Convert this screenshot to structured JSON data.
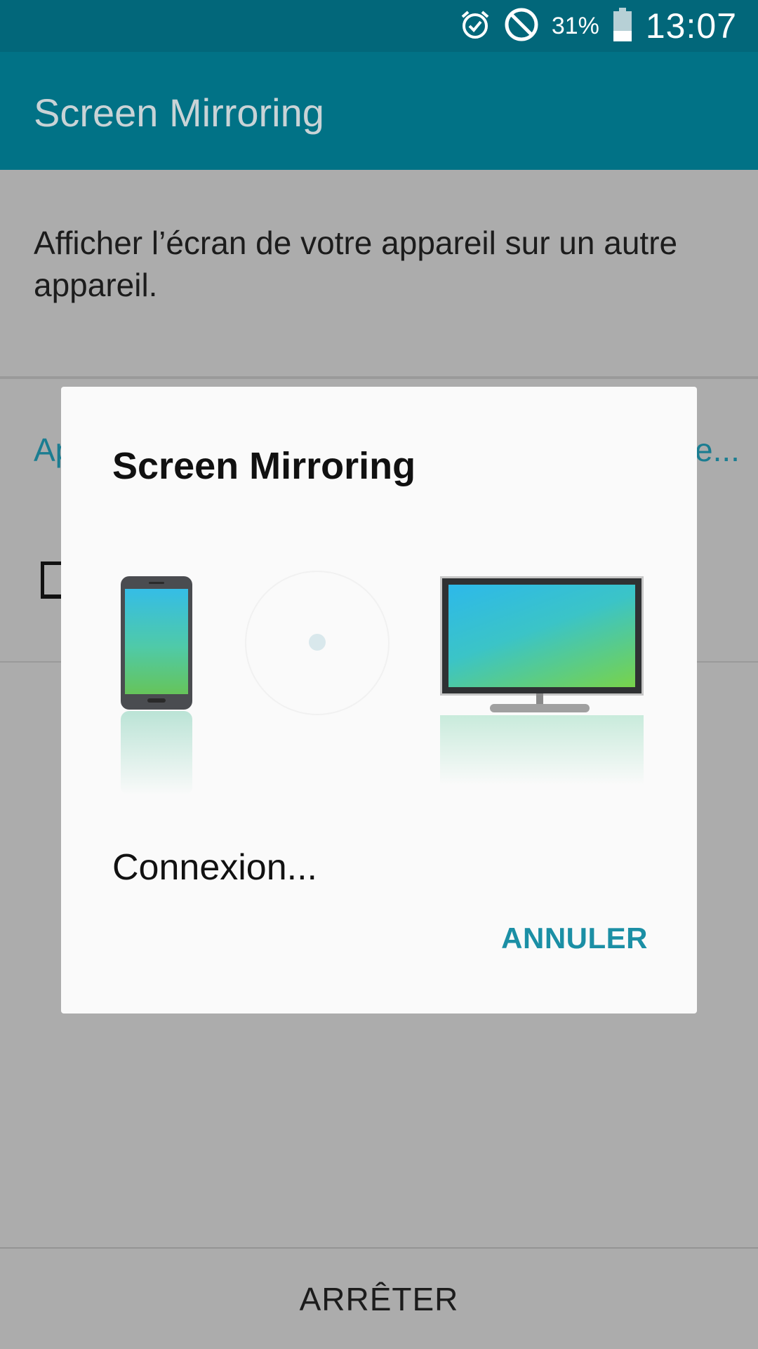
{
  "status_bar": {
    "battery_percent": "31%",
    "time": "13:07",
    "icons": [
      "alarm-icon",
      "do-not-disturb-icon",
      "battery-icon"
    ],
    "background": "#02677a"
  },
  "app_bar": {
    "title": "Screen Mirroring",
    "background": "#017286"
  },
  "main": {
    "description": "Afficher l’écran de votre appareil sur un autre appareil.",
    "section_label_left": "Ap",
    "section_label_right": "e..."
  },
  "dialog": {
    "title": "Screen Mirroring",
    "status": "Connexion...",
    "cancel_label": "ANNULER",
    "accent": "#1b8fa5"
  },
  "bottom": {
    "stop_label": "ARRÊTER"
  }
}
